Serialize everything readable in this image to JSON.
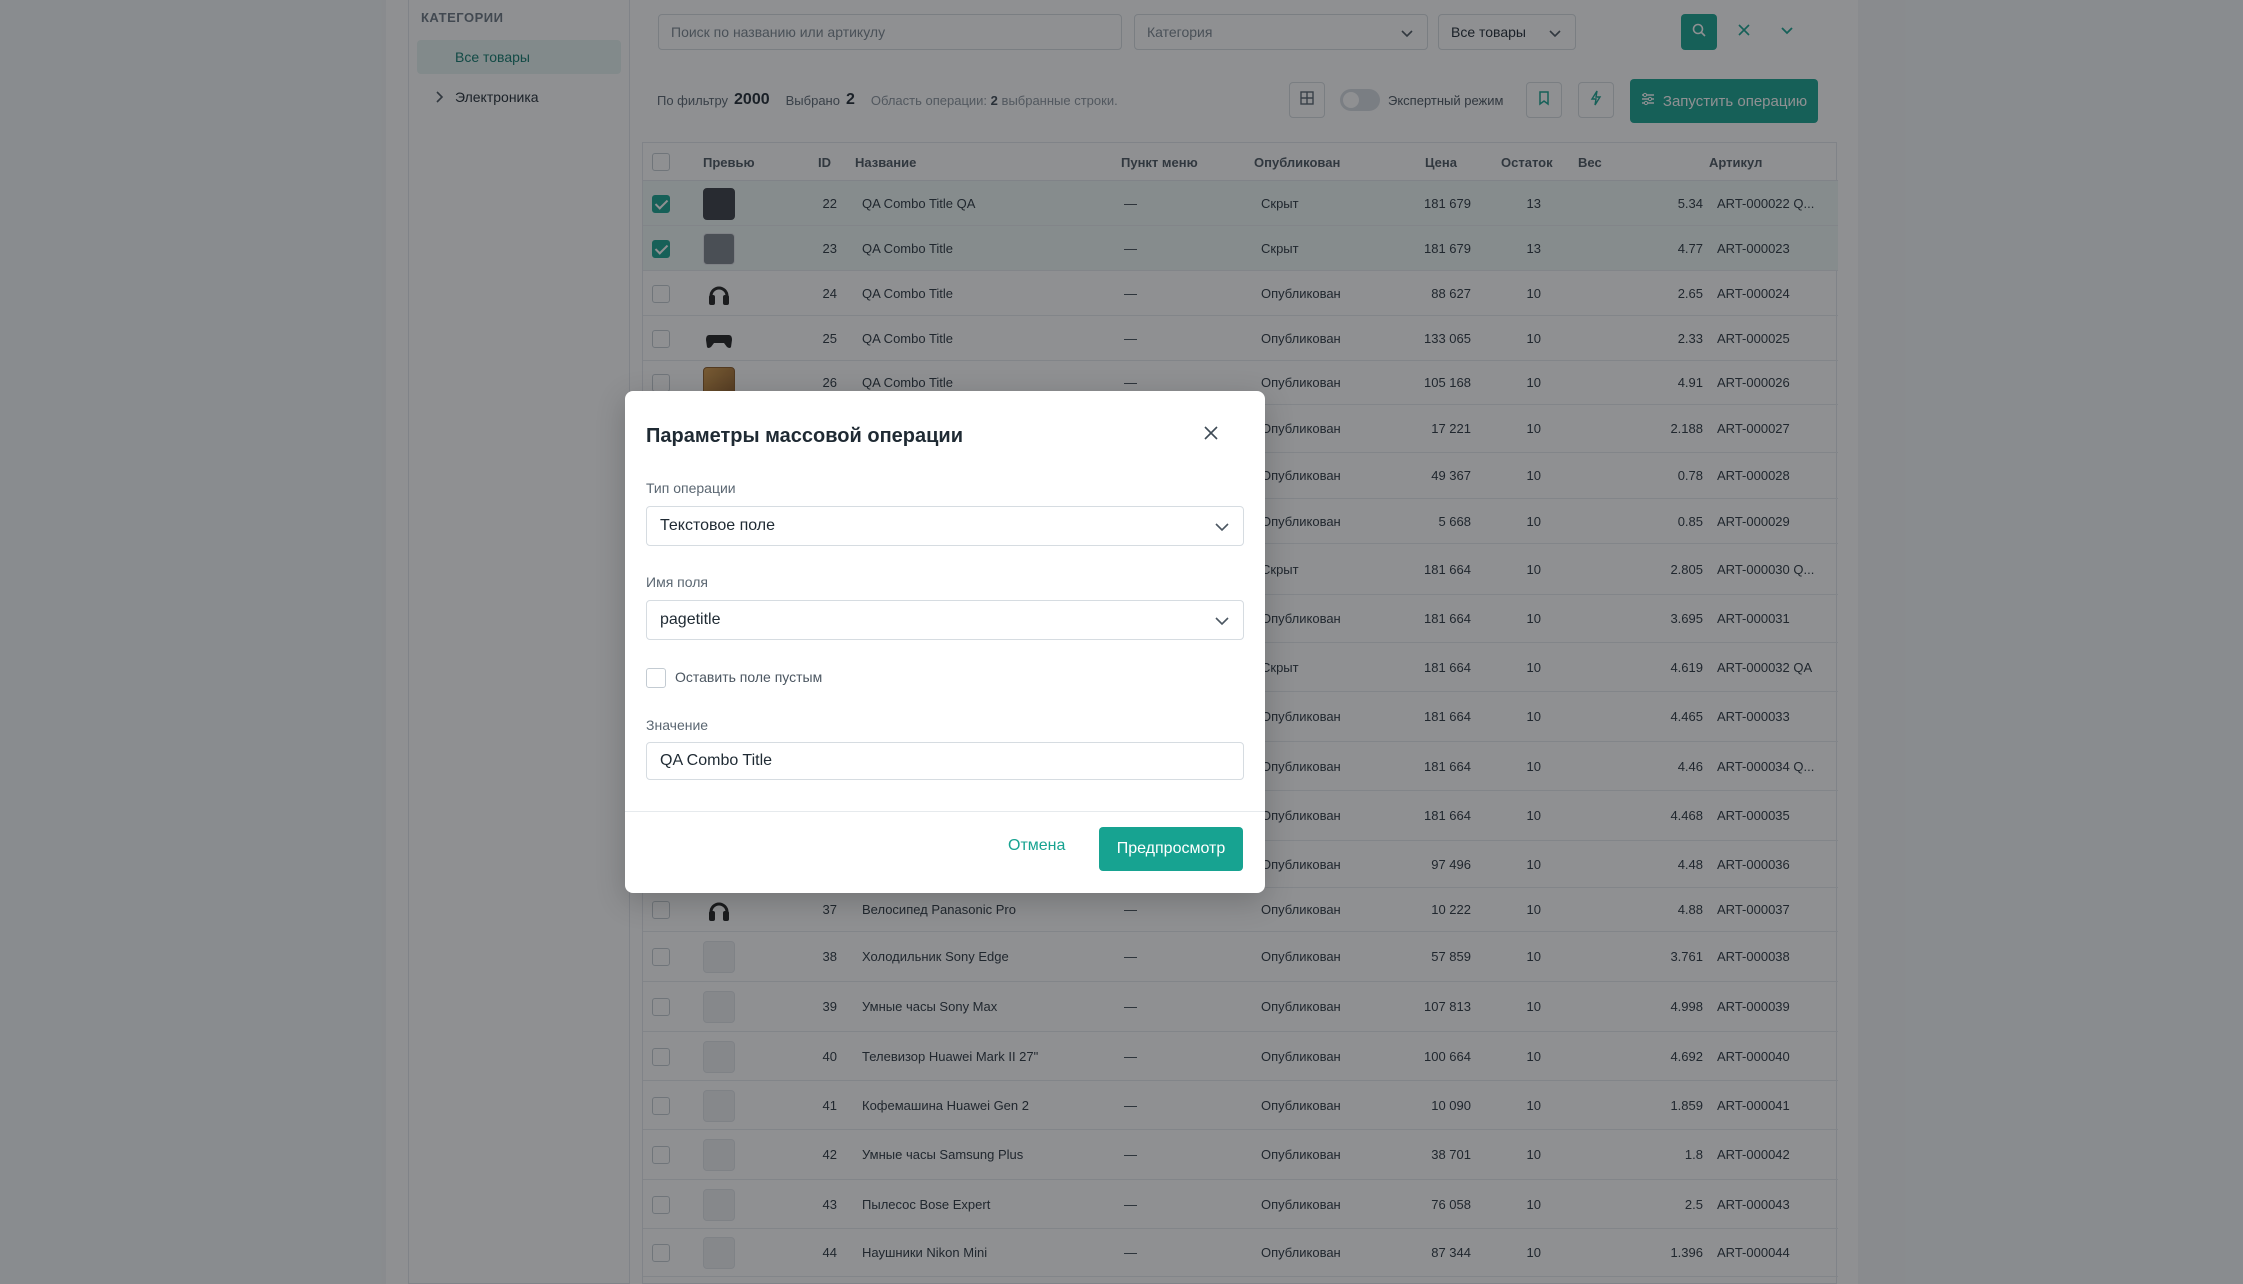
{
  "sidebar": {
    "title": "КАТЕГОРИИ",
    "items": [
      {
        "label": "Все товары",
        "active": true
      },
      {
        "label": "Электроника",
        "active": false
      }
    ]
  },
  "toolbar": {
    "search_placeholder": "Поиск по названию или артикулу",
    "category_placeholder": "Категория",
    "scope_value": "Все товары"
  },
  "stats": {
    "filter_label": "По фильтру",
    "filter_count": "2000",
    "selected_label": "Выбрано",
    "selected_count": "2",
    "scope_prefix": "Область операции:",
    "scope_count": "2",
    "scope_suffix": "выбранные строки.",
    "expert_mode_label": "Экспертный режим",
    "run_button_label": "Запустить операцию"
  },
  "table": {
    "headers": {
      "preview": "Превью",
      "id": "ID",
      "name": "Название",
      "menu": "Пункт меню",
      "published": "Опубликован",
      "price": "Цена",
      "stock": "Остаток",
      "weight": "Вес",
      "sku": "Артикул"
    },
    "rows": [
      {
        "id": "22",
        "name": "QA Combo Title QA",
        "menu": "—",
        "status": "Скрыт",
        "price": "181 679",
        "stock": "13",
        "weight": "5.34",
        "sku": "ART-000022 Q...",
        "selected": true,
        "thumb": "dark"
      },
      {
        "id": "23",
        "name": "QA Combo Title",
        "menu": "—",
        "status": "Скрыт",
        "price": "181 679",
        "stock": "13",
        "weight": "4.77",
        "sku": "ART-000023",
        "selected": true,
        "thumb": "gray"
      },
      {
        "id": "24",
        "name": "QA Combo Title",
        "menu": "—",
        "status": "Опубликован",
        "price": "88 627",
        "stock": "10",
        "weight": "2.65",
        "sku": "ART-000024",
        "selected": false,
        "thumb": "headphones"
      },
      {
        "id": "25",
        "name": "QA Combo Title",
        "menu": "—",
        "status": "Опубликован",
        "price": "133 065",
        "stock": "10",
        "weight": "2.33",
        "sku": "ART-000025",
        "selected": false,
        "thumb": "gamepad"
      },
      {
        "id": "26",
        "name": "QA Combo Title",
        "menu": "—",
        "status": "Опубликован",
        "price": "105 168",
        "stock": "10",
        "weight": "4.91",
        "sku": "ART-000026",
        "selected": false,
        "thumb": "photo"
      },
      {
        "id": "",
        "name": "",
        "menu": "",
        "status": "Опубликован",
        "price": "17 221",
        "stock": "10",
        "weight": "2.188",
        "sku": "ART-000027",
        "selected": false,
        "thumb": "empty"
      },
      {
        "id": "",
        "name": "",
        "menu": "",
        "status": "Опубликован",
        "price": "49 367",
        "stock": "10",
        "weight": "0.78",
        "sku": "ART-000028",
        "selected": false,
        "thumb": "empty"
      },
      {
        "id": "",
        "name": "",
        "menu": "",
        "status": "Опубликован",
        "price": "5 668",
        "stock": "10",
        "weight": "0.85",
        "sku": "ART-000029",
        "selected": false,
        "thumb": "empty"
      },
      {
        "id": "",
        "name": "",
        "menu": "",
        "status": "Скрыт",
        "price": "181 664",
        "stock": "10",
        "weight": "2.805",
        "sku": "ART-000030 Q...",
        "selected": false,
        "thumb": "empty"
      },
      {
        "id": "",
        "name": "",
        "menu": "",
        "status": "Опубликован",
        "price": "181 664",
        "stock": "10",
        "weight": "3.695",
        "sku": "ART-000031",
        "selected": false,
        "thumb": "empty"
      },
      {
        "id": "",
        "name": "",
        "menu": "",
        "status": "Скрыт",
        "price": "181 664",
        "stock": "10",
        "weight": "4.619",
        "sku": "ART-000032 QA",
        "selected": false,
        "thumb": "empty"
      },
      {
        "id": "",
        "name": "",
        "menu": "",
        "status": "Опубликован",
        "price": "181 664",
        "stock": "10",
        "weight": "4.465",
        "sku": "ART-000033",
        "selected": false,
        "thumb": "empty"
      },
      {
        "id": "",
        "name": "",
        "menu": "",
        "status": "Опубликован",
        "price": "181 664",
        "stock": "10",
        "weight": "4.46",
        "sku": "ART-000034 Q...",
        "selected": false,
        "thumb": "empty"
      },
      {
        "id": "",
        "name": "",
        "menu": "",
        "status": "Опубликован",
        "price": "181 664",
        "stock": "10",
        "weight": "4.468",
        "sku": "ART-000035",
        "selected": false,
        "thumb": "empty"
      },
      {
        "id": "",
        "name": "",
        "menu": "",
        "status": "Опубликован",
        "price": "97 496",
        "stock": "10",
        "weight": "4.48",
        "sku": "ART-000036",
        "selected": false,
        "thumb": "empty"
      },
      {
        "id": "37",
        "name": "Велосипед Panasonic Pro",
        "menu": "—",
        "status": "Опубликован",
        "price": "10 222",
        "stock": "10",
        "weight": "4.88",
        "sku": "ART-000037",
        "selected": false,
        "thumb": "headphones"
      },
      {
        "id": "38",
        "name": "Холодильник Sony Edge",
        "menu": "—",
        "status": "Опубликован",
        "price": "57 859",
        "stock": "10",
        "weight": "3.761",
        "sku": "ART-000038",
        "selected": false,
        "thumb": "empty"
      },
      {
        "id": "39",
        "name": "Умные часы Sony Max",
        "menu": "—",
        "status": "Опубликован",
        "price": "107 813",
        "stock": "10",
        "weight": "4.998",
        "sku": "ART-000039",
        "selected": false,
        "thumb": "empty"
      },
      {
        "id": "40",
        "name": "Телевизор Huawei Mark II 27\"",
        "menu": "—",
        "status": "Опубликован",
        "price": "100 664",
        "stock": "10",
        "weight": "4.692",
        "sku": "ART-000040",
        "selected": false,
        "thumb": "empty"
      },
      {
        "id": "41",
        "name": "Кофемашина Huawei Gen 2",
        "menu": "—",
        "status": "Опубликован",
        "price": "10 090",
        "stock": "10",
        "weight": "1.859",
        "sku": "ART-000041",
        "selected": false,
        "thumb": "empty"
      },
      {
        "id": "42",
        "name": "Умные часы Samsung Plus",
        "menu": "—",
        "status": "Опубликован",
        "price": "38 701",
        "stock": "10",
        "weight": "1.8",
        "sku": "ART-000042",
        "selected": false,
        "thumb": "empty"
      },
      {
        "id": "43",
        "name": "Пылесос Bose Expert",
        "menu": "—",
        "status": "Опубликован",
        "price": "76 058",
        "stock": "10",
        "weight": "2.5",
        "sku": "ART-000043",
        "selected": false,
        "thumb": "empty"
      },
      {
        "id": "44",
        "name": "Наушники Nikon Mini",
        "menu": "—",
        "status": "Опубликован",
        "price": "87 344",
        "stock": "10",
        "weight": "1.396",
        "sku": "ART-000044",
        "selected": false,
        "thumb": "empty"
      }
    ]
  },
  "modal": {
    "title": "Параметры массовой операции",
    "operation_type_label": "Тип операции",
    "operation_type_value": "Текстовое поле",
    "field_name_label": "Имя поля",
    "field_name_value": "pagetitle",
    "leave_empty_label": "Оставить поле пустым",
    "value_label": "Значение",
    "value_value": "QA Combo Title",
    "cancel_label": "Отмена",
    "preview_label": "Предпросмотр"
  },
  "colors": {
    "accent": "#17a391",
    "overlay": "rgba(20,24,28,0.48)"
  }
}
